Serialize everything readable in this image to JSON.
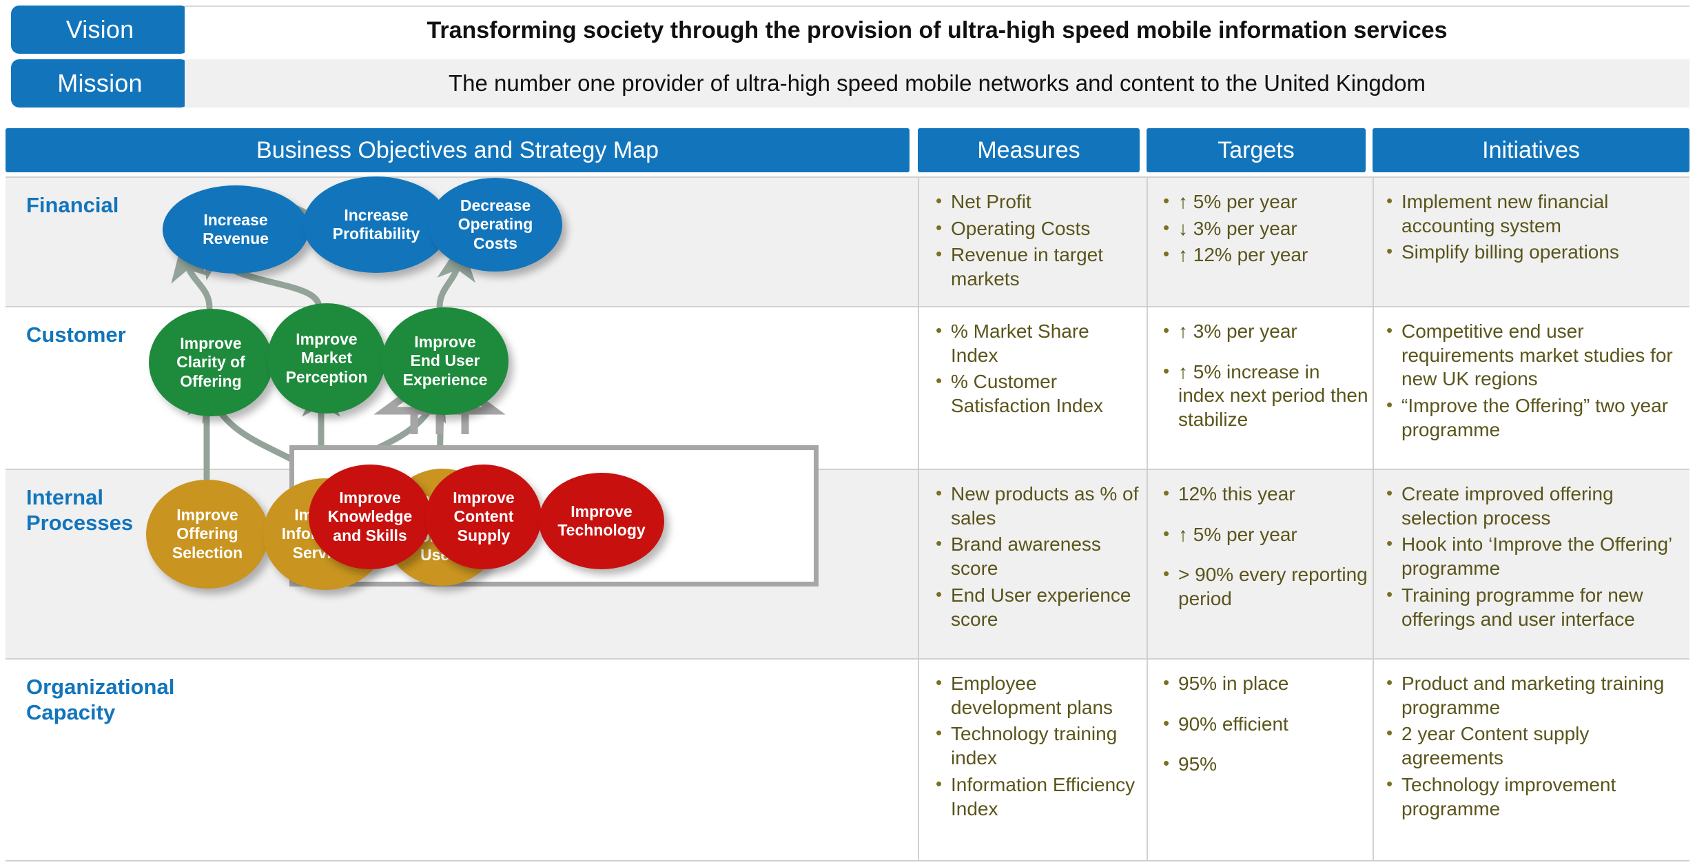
{
  "vision": {
    "tag": "Vision",
    "text": "Transforming society through the provision of ultra-high speed mobile information services"
  },
  "mission": {
    "tag": "Mission",
    "text": "The number one provider of ultra-high speed mobile networks and content to the United Kingdom"
  },
  "columns": {
    "map": "Business Objectives and Strategy Map",
    "measures": "Measures",
    "targets": "Targets",
    "initiatives": "Initiatives"
  },
  "perspectives": {
    "financial": "Financial",
    "customer": "Customer",
    "internal": "Internal\nProcesses",
    "organizational": "Organizational\nCapacity"
  },
  "nodes": {
    "increase_revenue": "Increase\nRevenue",
    "increase_profitability": "Increase\nProfitability",
    "decrease_operating_costs": "Decrease\nOperating\nCosts",
    "improve_clarity_of_offering": "Improve\nClarity of\nOffering",
    "improve_market_perception": "Improve\nMarket\nPerception",
    "improve_end_user_experience": "Improve\nEnd User\nExperience",
    "improve_offering_selection": "Improve\nOffering\nSelection",
    "improve_information_services": "Improve\nInformation\nServices",
    "improve_ease_of_use": "Improve\nEase of Use\nfor End\nUsers",
    "improve_knowledge_and_skills": "Improve\nKnowledge\nand Skills",
    "improve_content_supply": "Improve\nContent\nSupply",
    "improve_technology": "Improve\nTechnology"
  },
  "measures": {
    "financial": [
      "Net Profit",
      "Operating Costs",
      "Revenue in target markets"
    ],
    "customer": [
      "% Market Share Index",
      "% Customer Satisfaction Index"
    ],
    "internal": [
      "New products as % of sales",
      "Brand awareness score",
      "End User experience score"
    ],
    "organizational": [
      "Employee development plans",
      "Technology training index",
      "Information Efficiency Index"
    ]
  },
  "targets": {
    "financial": [
      "↑ 5% per year",
      "↓ 3% per year",
      "↑ 12% per year"
    ],
    "customer": [
      "↑ 3% per year",
      "↑ 5% increase in index next period then stabilize"
    ],
    "internal": [
      "12% this year",
      "↑ 5% per year",
      "> 90% every reporting period"
    ],
    "organizational": [
      "95% in place",
      "90% efficient",
      "95%"
    ]
  },
  "initiatives": {
    "financial": [
      "Implement new financial accounting system",
      "Simplify billing operations"
    ],
    "customer": [
      "Competitive end user requirements market studies for new UK regions",
      "“Improve the Offering” two year programme"
    ],
    "internal": [
      "Create improved offering selection process",
      "Hook into ‘Improve the Offering’ programme",
      "Training programme for new offerings and user interface"
    ],
    "organizational": [
      "Product and marketing training programme",
      "2 year Content supply agreements",
      "Technology improvement programme"
    ]
  },
  "colors": {
    "brand_blue": "#1275BC",
    "financial_node": "#1275BC",
    "customer_node": "#1E8A3C",
    "internal_node": "#C9941F",
    "organizational_node": "#C8100F",
    "bullet_text": "#5a551b",
    "connector": "#93a399",
    "row_alt_background": "#f0f0f0"
  }
}
